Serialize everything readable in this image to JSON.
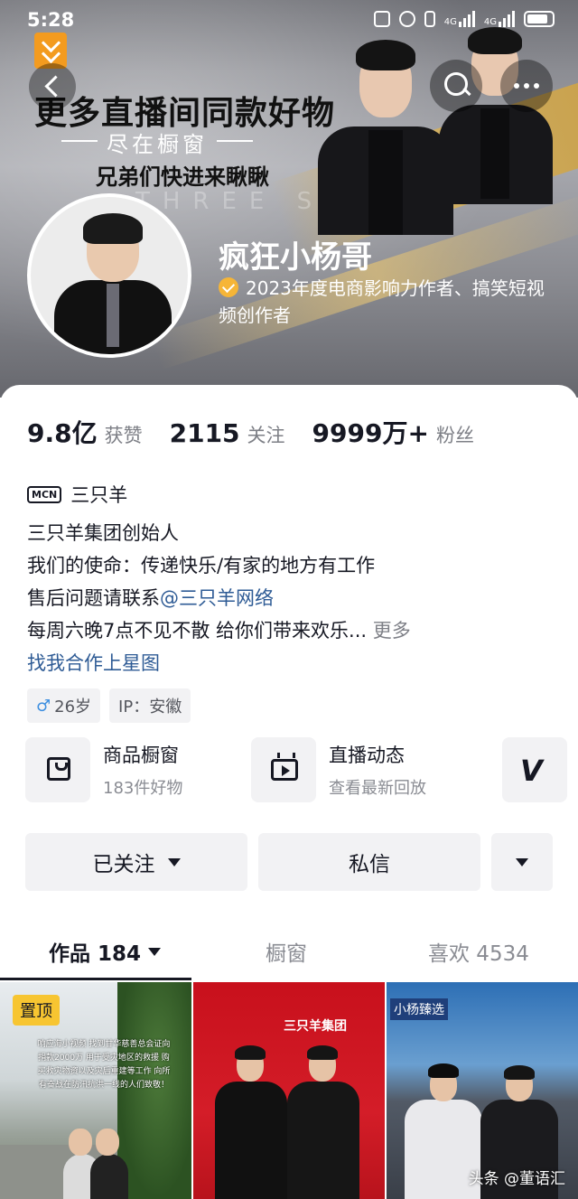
{
  "status_bar": {
    "time": "5:28",
    "network_1": "4G",
    "network_2": "4G",
    "icons": [
      "nfc-icon",
      "alarm-icon",
      "vibrate-icon",
      "signal-icon",
      "signal-icon",
      "battery-icon"
    ]
  },
  "header": {
    "promo_title": "更多直播间同款好物",
    "promo_subtitle": "尽在橱窗",
    "promo_cta": "兄弟们快进来瞅瞅",
    "watermark": "THREE SHEEP",
    "accent_color": "#f39b1f"
  },
  "profile": {
    "name": "疯狂小杨哥",
    "verified_text": "2023年度电商影响力作者、搞笑短视频创作者",
    "verified_color": "#f6b537"
  },
  "stats": [
    {
      "num": "9.8亿",
      "label": "获赞"
    },
    {
      "num": "2115",
      "label": "关注"
    },
    {
      "num": "9999万+",
      "label": "粉丝"
    }
  ],
  "mcn": {
    "badge": "MCN",
    "name": "三只羊"
  },
  "bio": {
    "line1": "三只羊集团创始人",
    "line2": "我们的使命：传递快乐/有家的地方有工作",
    "line3_prefix": "售后问题请联系",
    "line3_link": "@三只羊网络",
    "line4": "每周六晚7点不见不散  给你们带来欢乐...",
    "line4_more": "更多",
    "line5": "找我合作上星图"
  },
  "tags": {
    "age": "26岁",
    "ip": "IP：安徽"
  },
  "features": {
    "shop_title": "商品橱窗",
    "shop_sub": "183件好物",
    "live_title": "直播动态",
    "live_sub": "查看最新回放"
  },
  "actions": {
    "follow": "已关注",
    "message": "私信"
  },
  "tabs": {
    "works": "作品 184",
    "showcase": "橱窗",
    "likes": "喜欢 4534"
  },
  "grid": {
    "pin": "置顶",
    "notice": "响应海小视频 找到甘华慈善总会证向捐款2000万 用于受灾地区的救援 购买救灾物资以及灾后重建等工作 向所有奋战在防汛抗洪一线的人们致敬！",
    "banner2": "三只羊集团",
    "board3": "小杨臻选"
  },
  "footer": {
    "watermark": "头条 @董语汇"
  }
}
